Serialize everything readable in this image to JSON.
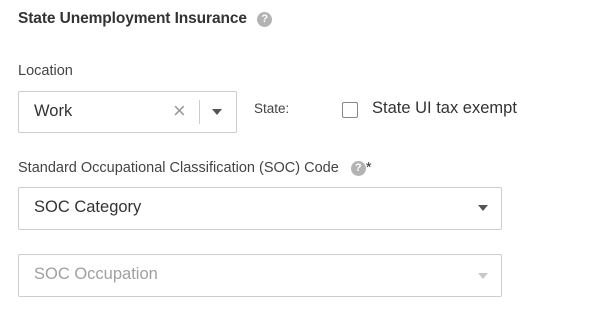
{
  "section": {
    "title": "State Unemployment Insurance",
    "help_icon": "question-circle-icon"
  },
  "location": {
    "label": "Location",
    "value": "Work",
    "clear_glyph": "×",
    "state_label": "State:",
    "tax_exempt_label": "State UI tax exempt",
    "tax_exempt_checked": false
  },
  "soc": {
    "label": "Standard Occupational Classification (SOC) Code",
    "required_marker": "*",
    "category_value": "SOC Category",
    "occupation_value": "SOC Occupation",
    "occupation_disabled": true
  },
  "colors": {
    "border": "#cccccc",
    "help_icon": "#b3b3b3",
    "disabled_text": "#a0a0a0"
  }
}
